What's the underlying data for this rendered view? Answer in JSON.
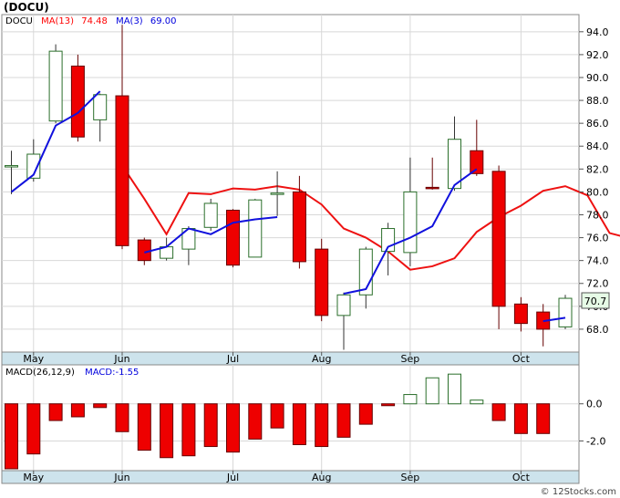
{
  "header": {
    "ticker": "(DOCU)",
    "legend": [
      {
        "label": "DOCU",
        "color": "#000000"
      },
      {
        "label": "MA(13)",
        "value": "74.48",
        "color": "#ff0000"
      },
      {
        "label": "MA(3)",
        "value": "69.00",
        "color": "#0000dd"
      }
    ],
    "last_price_label": "70.7"
  },
  "macd_header": {
    "label": "MACD(26,12,9)",
    "value_label": "MACD:-1.55"
  },
  "footer": {
    "credit": "© 12Stocks.com"
  },
  "colors": {
    "up": "#ffffff",
    "down": "#ee0000",
    "ma13": "#ee1111",
    "ma3": "#1111dd",
    "axis_band": "#cde3ec",
    "grid": "#d8d8d8",
    "macd_bar": "#ee0000"
  },
  "chart_data": [
    {
      "type": "candlestick",
      "title": "(DOCU)",
      "ylim": [
        66,
        95.5
      ],
      "y_ticks": [
        68,
        70,
        72,
        74,
        76,
        78,
        80,
        82,
        84,
        86,
        88,
        90,
        92,
        94
      ],
      "y_tick_labels": [
        "68.0",
        "70.0",
        "72.0",
        "74.0",
        "76.0",
        "78.0",
        "80.0",
        "82.0",
        "84.0",
        "86.0",
        "88.0",
        "90.0",
        "92.0",
        "94.0"
      ],
      "x_labels": [
        {
          "label": "May",
          "index": 1
        },
        {
          "label": "Jun",
          "index": 5
        },
        {
          "label": "Jul",
          "index": 10
        },
        {
          "label": "Aug",
          "index": 14
        },
        {
          "label": "Sep",
          "index": 18
        },
        {
          "label": "Oct",
          "index": 23
        }
      ],
      "candles": [
        {
          "o": 82.3,
          "h": 83.6,
          "l": 79.8,
          "c": 82.3
        },
        {
          "o": 81.2,
          "h": 84.6,
          "l": 80.9,
          "c": 83.3
        },
        {
          "o": 86.2,
          "h": 92.9,
          "l": 86.0,
          "c": 92.3
        },
        {
          "o": 91.0,
          "h": 92.0,
          "l": 84.4,
          "c": 84.8
        },
        {
          "o": 86.3,
          "h": 88.6,
          "l": 84.4,
          "c": 88.5
        },
        {
          "o": 88.4,
          "h": 94.6,
          "l": 75.0,
          "c": 75.3
        },
        {
          "o": 75.8,
          "h": 76.0,
          "l": 73.6,
          "c": 74.0
        },
        {
          "o": 74.2,
          "h": 76.0,
          "l": 74.0,
          "c": 75.2
        },
        {
          "o": 75.0,
          "h": 77.0,
          "l": 73.6,
          "c": 76.8
        },
        {
          "o": 76.9,
          "h": 79.4,
          "l": 76.6,
          "c": 79.0
        },
        {
          "o": 78.4,
          "h": 78.5,
          "l": 73.4,
          "c": 73.6
        },
        {
          "o": 74.3,
          "h": 79.4,
          "l": 74.3,
          "c": 79.3
        },
        {
          "o": 79.8,
          "h": 81.8,
          "l": 77.9,
          "c": 79.9
        },
        {
          "o": 80.0,
          "h": 81.4,
          "l": 73.3,
          "c": 73.9
        },
        {
          "o": 75.0,
          "h": 75.9,
          "l": 68.7,
          "c": 69.2
        },
        {
          "o": 69.2,
          "h": 71.2,
          "l": 66.2,
          "c": 71.0
        },
        {
          "o": 71.0,
          "h": 75.2,
          "l": 69.8,
          "c": 75.0
        },
        {
          "o": 74.8,
          "h": 77.3,
          "l": 72.7,
          "c": 76.8
        },
        {
          "o": 74.7,
          "h": 83.0,
          "l": 73.5,
          "c": 80.0
        },
        {
          "o": 80.4,
          "h": 83.0,
          "l": 80.2,
          "c": 80.3
        },
        {
          "o": 80.3,
          "h": 86.6,
          "l": 80.1,
          "c": 84.6
        },
        {
          "o": 83.6,
          "h": 86.3,
          "l": 81.4,
          "c": 81.6
        },
        {
          "o": 81.8,
          "h": 82.3,
          "l": 68.0,
          "c": 70.0
        },
        {
          "o": 70.2,
          "h": 70.8,
          "l": 67.8,
          "c": 68.5
        },
        {
          "o": 69.5,
          "h": 70.2,
          "l": 66.5,
          "c": 68.0
        },
        {
          "o": 68.2,
          "h": 71.0,
          "l": 68.0,
          "c": 70.7
        }
      ],
      "ma13": {
        "name": "MA(13)",
        "start_index": 5,
        "values": [
          82.3,
          79.4,
          76.3,
          79.9,
          79.8,
          80.3,
          80.2,
          80.5,
          80.2,
          78.9,
          76.8,
          76.0,
          74.8,
          73.2,
          73.5,
          74.2,
          76.5,
          77.8,
          78.8,
          80.1,
          80.5,
          79.7,
          76.4,
          75.9,
          74.9,
          74.48
        ]
      },
      "ma3": {
        "name": "MA(3)",
        "segments": [
          {
            "start_index": 0,
            "values": [
              80.0,
              81.5,
              85.8,
              86.9,
              88.8
            ]
          },
          {
            "start_index": 6,
            "values": [
              74.7,
              75.2,
              76.8,
              76.3,
              77.3,
              77.6,
              77.8
            ]
          },
          {
            "start_index": 15,
            "values": [
              71.1,
              71.5,
              75.2,
              76.0,
              77.0,
              80.6,
              82.0
            ]
          },
          {
            "start_index": 24,
            "values": [
              68.7,
              69.0
            ]
          }
        ]
      }
    },
    {
      "type": "bar",
      "title": "MACD(26,12,9)",
      "ylim": [
        -3.6,
        2.1
      ],
      "y_ticks": [
        0,
        -2
      ],
      "y_tick_labels": [
        "0.0",
        "-2.0"
      ],
      "x_labels": [
        {
          "label": "May",
          "index": 1
        },
        {
          "label": "Jun",
          "index": 5
        },
        {
          "label": "Jul",
          "index": 10
        },
        {
          "label": "Aug",
          "index": 14
        },
        {
          "label": "Sep",
          "index": 18
        },
        {
          "label": "Oct",
          "index": 23
        }
      ],
      "values": [
        -3.5,
        -2.7,
        -0.9,
        -0.7,
        -0.2,
        -1.5,
        -2.5,
        -2.9,
        -2.8,
        -2.3,
        -2.6,
        -1.9,
        -1.3,
        -2.2,
        -2.3,
        -1.8,
        -1.1,
        -0.1,
        0.5,
        1.4,
        1.6,
        0.2,
        -0.9,
        -1.6,
        -1.6
      ]
    }
  ]
}
